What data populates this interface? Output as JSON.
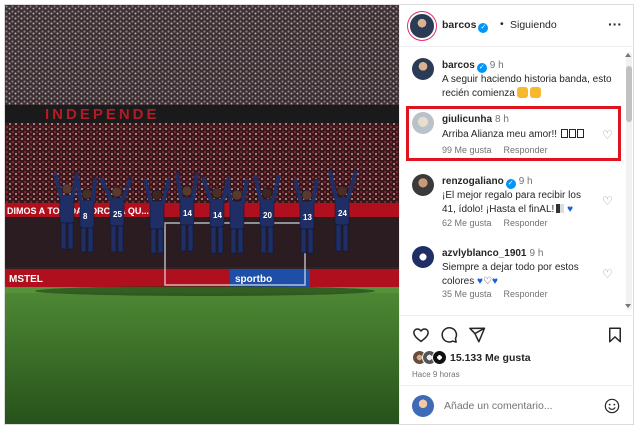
{
  "post": {
    "author": "barcos",
    "follow_dot": "•",
    "follow_label": "Siguiendo",
    "more_icon": "more-horizontal-icon",
    "photo_banners": {
      "stand_text": "INDEPENDE",
      "ad_text": "DIMOS A TO... DA TORCIDA QU...",
      "sponsor_text": "MSTEL",
      "sponsor_text_2": "sportbo"
    }
  },
  "caption": {
    "user": "barcos",
    "time": "9 h",
    "text": "A seguir haciendo historia banda, esto recién comienza"
  },
  "comments": [
    {
      "user": "giulicunha",
      "time": "8 h",
      "text": "Arriba Alianza meu amor!!",
      "likes": "99 Me gusta",
      "reply": "Responder"
    },
    {
      "user": "renzogaliano",
      "time": "9 h",
      "text": "¡El mejor regalo para recibir los 41, ídolo! ¡Hasta el finAL!",
      "likes": "62 Me gusta",
      "reply": "Responder"
    },
    {
      "user": "azvlyblanco_1901",
      "time": "9 h",
      "text": "Siempre a dejar todo por estos colores",
      "likes": "35 Me gusta",
      "reply": "Responder"
    }
  ],
  "actions": {
    "like_icon": "heart-icon",
    "comment_icon": "comment-icon",
    "share_icon": "send-icon",
    "save_icon": "bookmark-icon"
  },
  "likes": {
    "count_text": "15.133 Me gusta"
  },
  "post_date": "Hace 9 horas",
  "add_comment": {
    "placeholder": "Añade un comentario...",
    "emoji_icon": "smiley-icon"
  },
  "colors": {
    "highlight": "#e0141e",
    "verified": "#0095f6",
    "jersey": "#1f2f66"
  }
}
